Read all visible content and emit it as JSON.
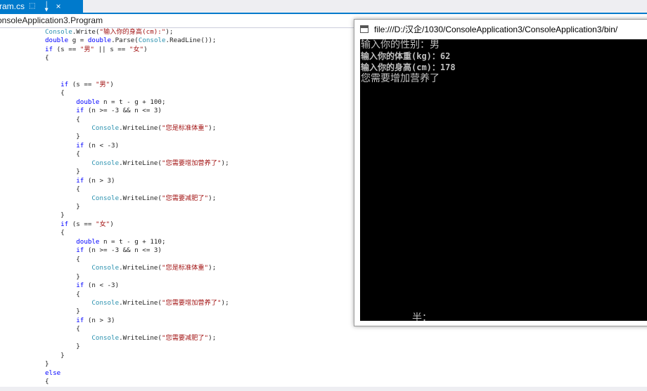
{
  "editor": {
    "tab": {
      "title": "ram.cs"
    },
    "nav": {
      "class_path": "onsoleApplication3.Program"
    },
    "code_lines": [
      [
        {
          "t": "Console",
          "c": "ty"
        },
        {
          "t": ".Write(",
          "c": ""
        },
        {
          "t": "\"输入你的身高(cm):\"",
          "c": "str"
        },
        {
          "t": ");",
          "c": ""
        }
      ],
      [
        {
          "t": "double",
          "c": "kw"
        },
        {
          "t": " g = ",
          "c": ""
        },
        {
          "t": "double",
          "c": "kw"
        },
        {
          "t": ".Parse(",
          "c": ""
        },
        {
          "t": "Console",
          "c": "ty"
        },
        {
          "t": ".ReadLine());",
          "c": ""
        }
      ],
      [
        {
          "t": "if",
          "c": "kw"
        },
        {
          "t": " (s == ",
          "c": ""
        },
        {
          "t": "\"男\"",
          "c": "str"
        },
        {
          "t": " || s == ",
          "c": ""
        },
        {
          "t": "\"女\"",
          "c": "str"
        },
        {
          "t": ")",
          "c": ""
        }
      ],
      [
        {
          "t": "{",
          "c": ""
        }
      ],
      [],
      [],
      [
        {
          "t": "    if",
          "c": "kw"
        },
        {
          "t": " (s == ",
          "c": ""
        },
        {
          "t": "\"男\"",
          "c": "str"
        },
        {
          "t": ")",
          "c": ""
        }
      ],
      [
        {
          "t": "    {",
          "c": ""
        }
      ],
      [
        {
          "t": "        double",
          "c": "kw"
        },
        {
          "t": " n = t - g + 100;",
          "c": ""
        }
      ],
      [
        {
          "t": "        if",
          "c": "kw"
        },
        {
          "t": " (n >= -3 && n <= 3)",
          "c": ""
        }
      ],
      [
        {
          "t": "        {",
          "c": ""
        }
      ],
      [
        {
          "t": "            Console",
          "c": "ty"
        },
        {
          "t": ".WriteLine(",
          "c": ""
        },
        {
          "t": "\"您是标准体重\"",
          "c": "str"
        },
        {
          "t": ");",
          "c": ""
        }
      ],
      [
        {
          "t": "        }",
          "c": ""
        }
      ],
      [
        {
          "t": "        if",
          "c": "kw"
        },
        {
          "t": " (n < -3)",
          "c": ""
        }
      ],
      [
        {
          "t": "        {",
          "c": ""
        }
      ],
      [
        {
          "t": "            Console",
          "c": "ty"
        },
        {
          "t": ".WriteLine(",
          "c": ""
        },
        {
          "t": "\"您需要增加营养了\"",
          "c": "str"
        },
        {
          "t": ");",
          "c": ""
        }
      ],
      [
        {
          "t": "        }",
          "c": ""
        }
      ],
      [
        {
          "t": "        if",
          "c": "kw"
        },
        {
          "t": " (n > 3)",
          "c": ""
        }
      ],
      [
        {
          "t": "        {",
          "c": ""
        }
      ],
      [
        {
          "t": "            Console",
          "c": "ty"
        },
        {
          "t": ".WriteLine(",
          "c": ""
        },
        {
          "t": "\"您需要减肥了\"",
          "c": "str"
        },
        {
          "t": ");",
          "c": ""
        }
      ],
      [
        {
          "t": "        }",
          "c": ""
        }
      ],
      [
        {
          "t": "    }",
          "c": ""
        }
      ],
      [
        {
          "t": "    if",
          "c": "kw"
        },
        {
          "t": " (s == ",
          "c": ""
        },
        {
          "t": "\"女\"",
          "c": "str"
        },
        {
          "t": ")",
          "c": ""
        }
      ],
      [
        {
          "t": "    {",
          "c": ""
        }
      ],
      [
        {
          "t": "        double",
          "c": "kw"
        },
        {
          "t": " n = t - g + 110;",
          "c": ""
        }
      ],
      [
        {
          "t": "        if",
          "c": "kw"
        },
        {
          "t": " (n >= -3 && n <= 3)",
          "c": ""
        }
      ],
      [
        {
          "t": "        {",
          "c": ""
        }
      ],
      [
        {
          "t": "            Console",
          "c": "ty"
        },
        {
          "t": ".WriteLine(",
          "c": ""
        },
        {
          "t": "\"您是标准体重\"",
          "c": "str"
        },
        {
          "t": ");",
          "c": ""
        }
      ],
      [
        {
          "t": "        }",
          "c": ""
        }
      ],
      [
        {
          "t": "        if",
          "c": "kw"
        },
        {
          "t": " (n < -3)",
          "c": ""
        }
      ],
      [
        {
          "t": "        {",
          "c": ""
        }
      ],
      [
        {
          "t": "            Console",
          "c": "ty"
        },
        {
          "t": ".WriteLine(",
          "c": ""
        },
        {
          "t": "\"您需要增加营养了\"",
          "c": "str"
        },
        {
          "t": ");",
          "c": ""
        }
      ],
      [
        {
          "t": "        }",
          "c": ""
        }
      ],
      [
        {
          "t": "        if",
          "c": "kw"
        },
        {
          "t": " (n > 3)",
          "c": ""
        }
      ],
      [
        {
          "t": "        {",
          "c": ""
        }
      ],
      [
        {
          "t": "            Console",
          "c": "ty"
        },
        {
          "t": ".WriteLine(",
          "c": ""
        },
        {
          "t": "\"您需要减肥了\"",
          "c": "str"
        },
        {
          "t": ");",
          "c": ""
        }
      ],
      [
        {
          "t": "        }",
          "c": ""
        }
      ],
      [
        {
          "t": "    }",
          "c": ""
        }
      ],
      [
        {
          "t": "}",
          "c": ""
        }
      ],
      [
        {
          "t": "else",
          "c": "kw"
        }
      ],
      [
        {
          "t": "{",
          "c": ""
        }
      ]
    ]
  },
  "console": {
    "title": "file:///D:/汉企/1030/ConsoleApplication3/ConsoleApplication3/bin/",
    "lines": [
      "输入你的性别：男",
      "输入你的体重(kg)：62",
      "输入你的身高(cm)：178",
      "您需要增加营养了"
    ],
    "ime_text": "半："
  },
  "colors": {
    "accent": "#007acc",
    "keyword": "#0000ff",
    "type": "#2b91af",
    "string": "#a31515",
    "console_bg": "#000000",
    "console_fg": "#c0c0c0"
  }
}
